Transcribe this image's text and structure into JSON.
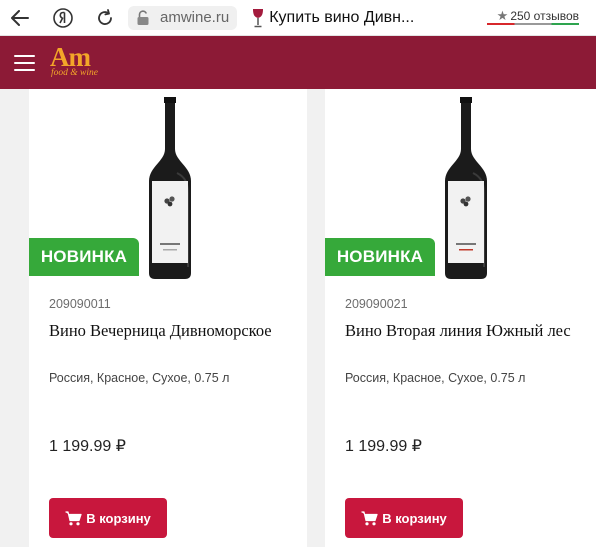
{
  "browser": {
    "url": "amwine.ru",
    "tab_title": "Купить вино Дивн...",
    "reviews": "250 отзывов"
  },
  "site": {
    "logo_text": "Am",
    "logo_tagline": "food & wine",
    "brand_color": "#8c1a36",
    "logo_color": "#f3a629"
  },
  "products": [
    {
      "badge": "НОВИНКА",
      "sku": "209090011",
      "name": "Вино Вечерница Дивноморское",
      "attributes": "Россия, Красное, Сухое, 0.75 л",
      "price": "1 199.99 ₽",
      "button_label": "В корзину"
    },
    {
      "badge": "НОВИНКА",
      "sku": "209090021",
      "name": "Вино Вторая линия Южный лес",
      "attributes": "Россия, Красное, Сухое, 0.75 л",
      "price": "1 199.99 ₽",
      "button_label": "В корзину"
    }
  ],
  "colors": {
    "badge_green": "#36a93a",
    "button_red": "#c8173d"
  }
}
